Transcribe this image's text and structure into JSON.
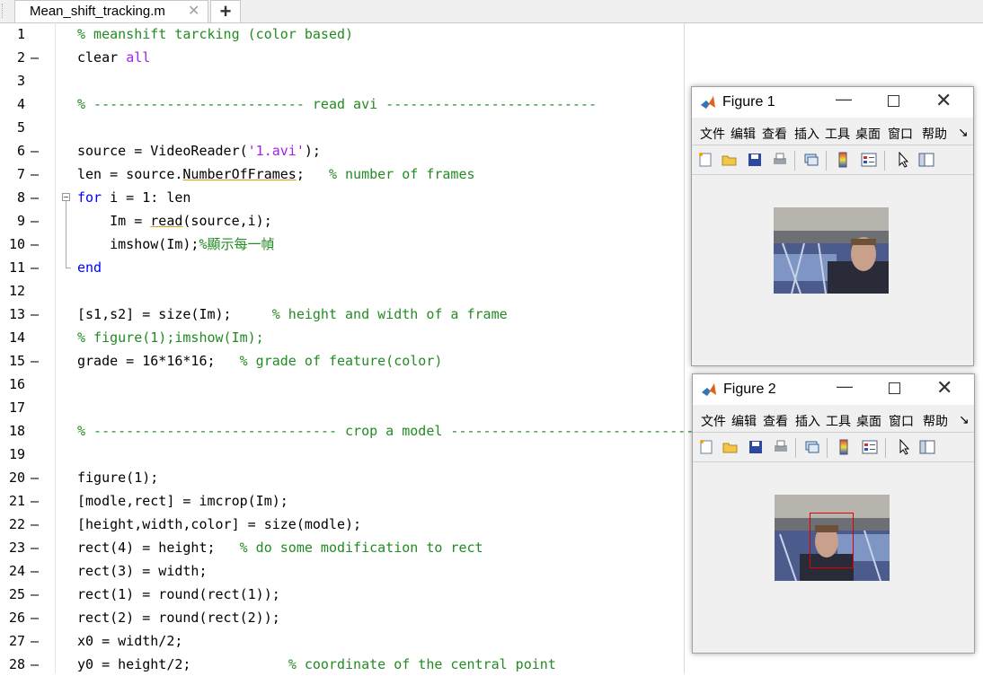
{
  "tabs": {
    "active_file": "Mean_shift_tracking.m",
    "close_glyph": "✕",
    "add_glyph": "+"
  },
  "editor": {
    "lines": [
      {
        "n": "1",
        "d": "",
        "parts": [
          {
            "c": "cm",
            "t": "% meanshift tarcking (color based)"
          }
        ]
      },
      {
        "n": "2",
        "d": "—",
        "parts": [
          {
            "c": "tx",
            "t": "clear "
          },
          {
            "c": "st",
            "t": "all"
          }
        ]
      },
      {
        "n": "3",
        "d": "",
        "parts": []
      },
      {
        "n": "4",
        "d": "",
        "parts": [
          {
            "c": "cm",
            "t": "% -------------------------- read avi --------------------------"
          }
        ]
      },
      {
        "n": "5",
        "d": "",
        "parts": []
      },
      {
        "n": "6",
        "d": "—",
        "parts": [
          {
            "c": "tx",
            "t": "source = VideoReader("
          },
          {
            "c": "st",
            "t": "'1.avi'"
          },
          {
            "c": "tx",
            "t": ");"
          }
        ]
      },
      {
        "n": "7",
        "d": "—",
        "parts": [
          {
            "c": "tx",
            "t": "len = source."
          },
          {
            "c": "tx ul",
            "t": "NumberOfFrames"
          },
          {
            "c": "tx",
            "t": ";   "
          },
          {
            "c": "cm",
            "t": "% number of frames"
          }
        ]
      },
      {
        "n": "8",
        "d": "—",
        "parts": [
          {
            "c": "kw",
            "t": "for"
          },
          {
            "c": "tx",
            "t": " i = 1: len"
          }
        ]
      },
      {
        "n": "9",
        "d": "—",
        "parts": [
          {
            "c": "tx",
            "t": "    Im = "
          },
          {
            "c": "tx ul",
            "t": "read"
          },
          {
            "c": "tx",
            "t": "(source,i);"
          }
        ]
      },
      {
        "n": "10",
        "d": "—",
        "parts": [
          {
            "c": "tx",
            "t": "    imshow(Im);"
          },
          {
            "c": "cm",
            "t": "%顯示每一幀"
          }
        ]
      },
      {
        "n": "11",
        "d": "—",
        "parts": [
          {
            "c": "kw",
            "t": "end"
          }
        ]
      },
      {
        "n": "12",
        "d": "",
        "parts": []
      },
      {
        "n": "13",
        "d": "—",
        "parts": [
          {
            "c": "tx",
            "t": "[s1,s2] = size(Im);     "
          },
          {
            "c": "cm",
            "t": "% height and width of a frame"
          }
        ]
      },
      {
        "n": "14",
        "d": "",
        "parts": [
          {
            "c": "cm",
            "t": "% figure(1);imshow(Im);"
          }
        ]
      },
      {
        "n": "15",
        "d": "—",
        "parts": [
          {
            "c": "tx",
            "t": "grade = 16*16*16;   "
          },
          {
            "c": "cm",
            "t": "% grade of feature(color)"
          }
        ]
      },
      {
        "n": "16",
        "d": "",
        "parts": []
      },
      {
        "n": "17",
        "d": "",
        "parts": []
      },
      {
        "n": "18",
        "d": "",
        "parts": [
          {
            "c": "cm",
            "t": "% ------------------------------ crop a model ------------------------------"
          }
        ]
      },
      {
        "n": "19",
        "d": "",
        "parts": []
      },
      {
        "n": "20",
        "d": "—",
        "parts": [
          {
            "c": "tx",
            "t": "figure(1);"
          }
        ]
      },
      {
        "n": "21",
        "d": "—",
        "parts": [
          {
            "c": "tx",
            "t": "[modle,rect] = imcrop(Im);"
          }
        ]
      },
      {
        "n": "22",
        "d": "—",
        "parts": [
          {
            "c": "tx",
            "t": "[height,width,color] = size(modle);"
          }
        ]
      },
      {
        "n": "23",
        "d": "—",
        "parts": [
          {
            "c": "tx",
            "t": "rect(4) = height;   "
          },
          {
            "c": "cm",
            "t": "% do some modification to rect"
          }
        ]
      },
      {
        "n": "24",
        "d": "—",
        "parts": [
          {
            "c": "tx",
            "t": "rect(3) = width;"
          }
        ]
      },
      {
        "n": "25",
        "d": "—",
        "parts": [
          {
            "c": "tx",
            "t": "rect(1) = round(rect(1));"
          }
        ]
      },
      {
        "n": "26",
        "d": "—",
        "parts": [
          {
            "c": "tx",
            "t": "rect(2) = round(rect(2));"
          }
        ]
      },
      {
        "n": "27",
        "d": "—",
        "parts": [
          {
            "c": "tx",
            "t": "x0 = width/2;"
          }
        ]
      },
      {
        "n": "28",
        "d": "—",
        "parts": [
          {
            "c": "tx",
            "t": "y0 = height/2;            "
          },
          {
            "c": "cm",
            "t": "% coordinate of the central point"
          }
        ]
      }
    ]
  },
  "figure1": {
    "title": "Figure 1",
    "menu": [
      "文件",
      "编辑",
      "查看",
      "插入",
      "工具",
      "桌面",
      "窗口",
      "帮助"
    ],
    "menu_more": "↘"
  },
  "figure2": {
    "title": "Figure 2",
    "menu": [
      "文件",
      "编辑",
      "查看",
      "插入",
      "工具",
      "桌面",
      "窗口",
      "帮助"
    ],
    "menu_more": "↘"
  },
  "window_controls": {
    "minimize": "—",
    "close": "✕"
  },
  "colors": {
    "comment": "#228b22",
    "keyword": "#0000ff",
    "string": "#a020f0",
    "roi": "#e00000"
  }
}
